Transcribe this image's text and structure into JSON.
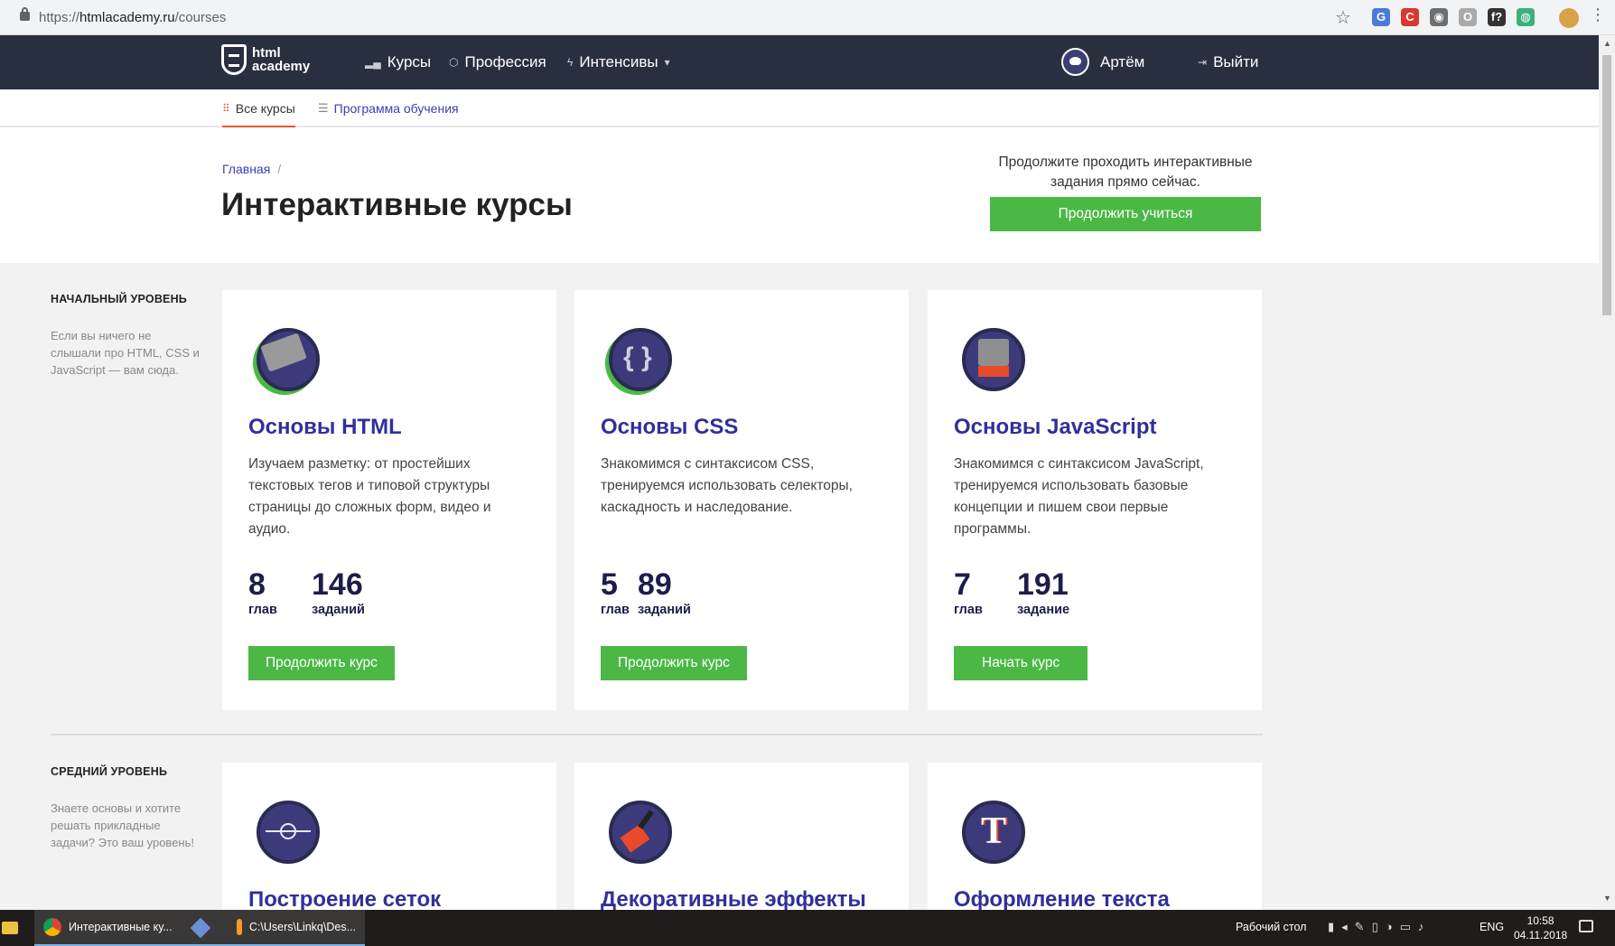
{
  "browser": {
    "url_prefix": "https://",
    "url_host": "htmlacademy.ru",
    "url_path": "/courses",
    "star_icon": "☆",
    "extensions": [
      {
        "glyph": "G",
        "color": "#4a7bd9"
      },
      {
        "glyph": "C",
        "color": "#d8382f"
      },
      {
        "glyph": "◉",
        "color": "#6f6f6f"
      },
      {
        "glyph": "O",
        "color": "#aaaaaa"
      },
      {
        "glyph": "f?",
        "color": "#333333"
      },
      {
        "glyph": "◍",
        "color": "#3bb07b"
      }
    ]
  },
  "header": {
    "logo_line1": "html",
    "logo_line2": "academy",
    "nav": [
      {
        "icon": "▂▄",
        "label": "Курсы"
      },
      {
        "icon": "⬡",
        "label": "Профессия"
      },
      {
        "icon": "ϟ",
        "label": "Интенсивы",
        "caret": "▾"
      }
    ],
    "user_name": "Артём",
    "logout_icon": "⇥",
    "logout_label": "Выйти"
  },
  "subnav": {
    "all_courses": "Все курсы",
    "program": "Программа обучения",
    "accent": "#e55b2b"
  },
  "page": {
    "breadcrumb": "Главная",
    "breadcrumb_sep": "/",
    "title": "Интерактивные курсы",
    "promo_text": "Продолжите проходить интерактивные задания прямо сейчас.",
    "promo_button": "Продолжить учиться"
  },
  "levels": [
    {
      "title": "НАЧАЛЬНЫЙ УРОВЕНЬ",
      "description": "Если вы ничего не слышали про HTML, CSS и JavaScript — вам сюда.",
      "courses": [
        {
          "title": "Основы HTML",
          "description": "Изучаем разметку: от простейших текстовых тегов и типовой структуры страницы до сложных форм, видео и аудио.",
          "chapters": "8",
          "chapters_label": "глав",
          "tasks": "146",
          "tasks_label": "заданий",
          "button": "Продолжить курс",
          "icon": "lego-brick-icon"
        },
        {
          "title": "Основы CSS",
          "description": "Знакомимся с синтаксисом CSS, тренируемся использовать селекторы, каскадность и наследование.",
          "chapters": "5",
          "chapters_label": "глав",
          "tasks": "89",
          "tasks_label": "заданий",
          "button": "Продолжить курс",
          "icon": "braces-icon",
          "glyph": "{ }"
        },
        {
          "title": "Основы JavaScript",
          "description": "Знакомимся с синтаксисом JavaScript, тренируемся использовать базовые концепции и пишем свои первые программы.",
          "chapters": "7",
          "chapters_label": "глав",
          "tasks": "191",
          "tasks_label": "задание",
          "button": "Начать курс",
          "icon": "rubiks-cube-icon"
        }
      ]
    },
    {
      "title": "СРЕДНИЙ УРОВЕНЬ",
      "description": "Знаете основы и хотите решать прикладные задачи? Это ваш уровень!",
      "courses": [
        {
          "title": "Построение сеток",
          "icon": "football-field-icon"
        },
        {
          "title": "Декоративные эффекты",
          "icon": "paint-brush-icon"
        },
        {
          "title": "Оформление текста",
          "icon": "letter-t-icon",
          "glyph": "T"
        }
      ]
    }
  ],
  "taskbar": {
    "tasks": [
      {
        "label": "Интерактивные ку...",
        "icon": "chrome-icon"
      },
      {
        "label": "",
        "icon": "git-icon"
      },
      {
        "label": "C:\\Users\\Linkq\\Des...",
        "icon": "sublime-icon"
      }
    ],
    "desktop_label": "Рабочий стол",
    "lang": "ENG",
    "time": "10:58",
    "date": "04.11.2018"
  }
}
